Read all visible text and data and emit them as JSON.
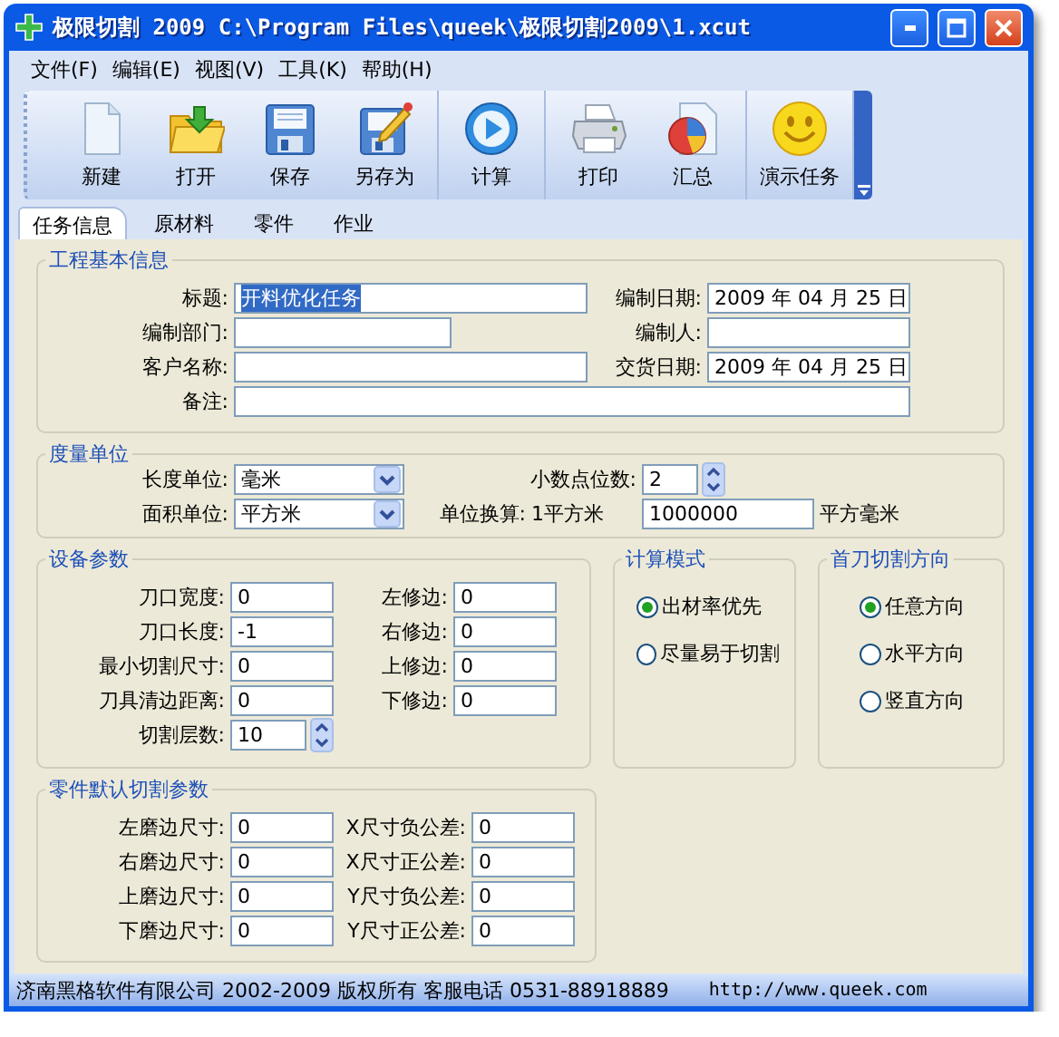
{
  "window": {
    "title": "极限切割 2009 C:\\Program Files\\queek\\极限切割2009\\1.xcut"
  },
  "menu": [
    "文件(F)",
    "编辑(E)",
    "视图(V)",
    "工具(K)",
    "帮助(H)"
  ],
  "toolbar": [
    [
      {
        "label": "新建",
        "kind": "new"
      },
      {
        "label": "打开",
        "kind": "open"
      },
      {
        "label": "保存",
        "kind": "save"
      },
      {
        "label": "另存为",
        "kind": "saveas"
      }
    ],
    [
      {
        "label": "计算",
        "kind": "calc"
      }
    ],
    [
      {
        "label": "打印",
        "kind": "print"
      },
      {
        "label": "汇总",
        "kind": "summary"
      }
    ],
    [
      {
        "label": "演示任务",
        "kind": "demo"
      }
    ]
  ],
  "tabs": [
    {
      "label": "任务信息",
      "selected": true
    },
    {
      "label": "原材料",
      "selected": false
    },
    {
      "label": "零件",
      "selected": false
    },
    {
      "label": "作业",
      "selected": false
    }
  ],
  "project_info": {
    "title": "工程基本信息",
    "title_field": {
      "label": "标题:",
      "kind": "text",
      "value": "开料优化任务",
      "highlighted": true
    },
    "compile_date": {
      "label": "编制日期:",
      "kind": "date",
      "value": "2009 年 04 月 25 日"
    },
    "department": {
      "label": "编制部门:",
      "kind": "text"
    },
    "compiler": {
      "label": "编制人:",
      "kind": "text"
    },
    "customer": {
      "label": "客户名称:",
      "kind": "text"
    },
    "delivery_date": {
      "label": "交货日期:",
      "kind": "date",
      "value": "2009 年 04 月 25 日"
    },
    "remarks": {
      "label": "备注:",
      "kind": "text"
    }
  },
  "units": {
    "title": "度量单位",
    "length_unit": {
      "label": "长度单位:",
      "kind": "select",
      "value": "毫米"
    },
    "decimals": {
      "label": "小数点位数:",
      "kind": "spin",
      "value": "2"
    },
    "area_unit": {
      "label": "面积单位:",
      "kind": "select",
      "value": "平方米"
    },
    "conversion": {
      "label": "单位换算:",
      "from": "1平方米",
      "kind": "text",
      "value": "1000000",
      "unit": "平方毫米"
    }
  },
  "equipment": {
    "title": "设备参数",
    "left": [
      {
        "label": "刀口宽度:",
        "kind": "text",
        "value": "0"
      },
      {
        "label": "刀口长度:",
        "kind": "text",
        "value": "-1"
      },
      {
        "label": "最小切割尺寸:",
        "kind": "text",
        "value": "0"
      },
      {
        "label": "刀具清边距离:",
        "kind": "text",
        "value": "0"
      },
      {
        "label": "切割层数:",
        "kind": "spin",
        "value": "10"
      }
    ],
    "right": [
      {
        "label": "左修边:",
        "kind": "text",
        "value": "0"
      },
      {
        "label": "右修边:",
        "kind": "text",
        "value": "0"
      },
      {
        "label": "上修边:",
        "kind": "text",
        "value": "0"
      },
      {
        "label": "下修边:",
        "kind": "text",
        "value": "0"
      }
    ]
  },
  "calc_mode": {
    "title": "计算模式",
    "options": [
      {
        "label": "出材率优先",
        "selected": true
      },
      {
        "label": "尽量易于切割",
        "selected": false
      }
    ]
  },
  "first_cut": {
    "title": "首刀切割方向",
    "options": [
      {
        "label": "任意方向",
        "selected": true
      },
      {
        "label": "水平方向",
        "selected": false
      },
      {
        "label": "竖直方向",
        "selected": false
      }
    ]
  },
  "part_defaults": {
    "title": "零件默认切割参数",
    "left": [
      {
        "label": "左磨边尺寸:",
        "kind": "text",
        "value": "0"
      },
      {
        "label": "右磨边尺寸:",
        "kind": "text",
        "value": "0"
      },
      {
        "label": "上磨边尺寸:",
        "kind": "text",
        "value": "0"
      },
      {
        "label": "下磨边尺寸:",
        "kind": "text",
        "value": "0"
      }
    ],
    "right": [
      {
        "label": "X尺寸负公差:",
        "kind": "text",
        "value": "0"
      },
      {
        "label": "X尺寸正公差:",
        "kind": "text",
        "value": "0"
      },
      {
        "label": "Y尺寸负公差:",
        "kind": "text",
        "value": "0"
      },
      {
        "label": "Y尺寸正公差:",
        "kind": "text",
        "value": "0"
      }
    ]
  },
  "status_bar": {
    "text": "济南黑格软件有限公司 2002-2009 版权所有 客服电话 0531-88918889",
    "url": "http://www.queek.com"
  }
}
